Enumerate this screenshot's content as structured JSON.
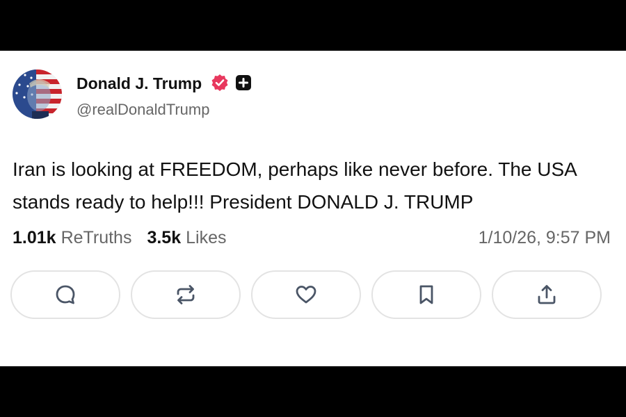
{
  "post": {
    "author": {
      "display_name": "Donald J. Trump",
      "handle": "@realDonaldTrump",
      "avatar_icon": "flag-portrait-avatar",
      "verified_icon": "verified-badge-icon",
      "verified_color": "#e8385e",
      "plus_icon": "plus-badge-icon"
    },
    "text": "Iran is looking at FREEDOM, perhaps like never before. The USA stands ready to help!!! President DONALD J. TRUMP",
    "stats": {
      "retruths_count": "1.01k",
      "retruths_label": "ReTruths",
      "likes_count": "3.5k",
      "likes_label": "Likes"
    },
    "timestamp": "1/10/26, 9:57 PM"
  },
  "actions": [
    {
      "name": "reply",
      "icon": "comment-icon"
    },
    {
      "name": "retruth",
      "icon": "repost-icon"
    },
    {
      "name": "like",
      "icon": "heart-icon"
    },
    {
      "name": "bookmark",
      "icon": "bookmark-icon"
    },
    {
      "name": "share",
      "icon": "share-icon"
    }
  ],
  "colors": {
    "text_primary": "#111111",
    "text_secondary": "#666666",
    "icon": "#4a5566",
    "button_border": "#e3e3e3",
    "letterbox": "#000000"
  }
}
